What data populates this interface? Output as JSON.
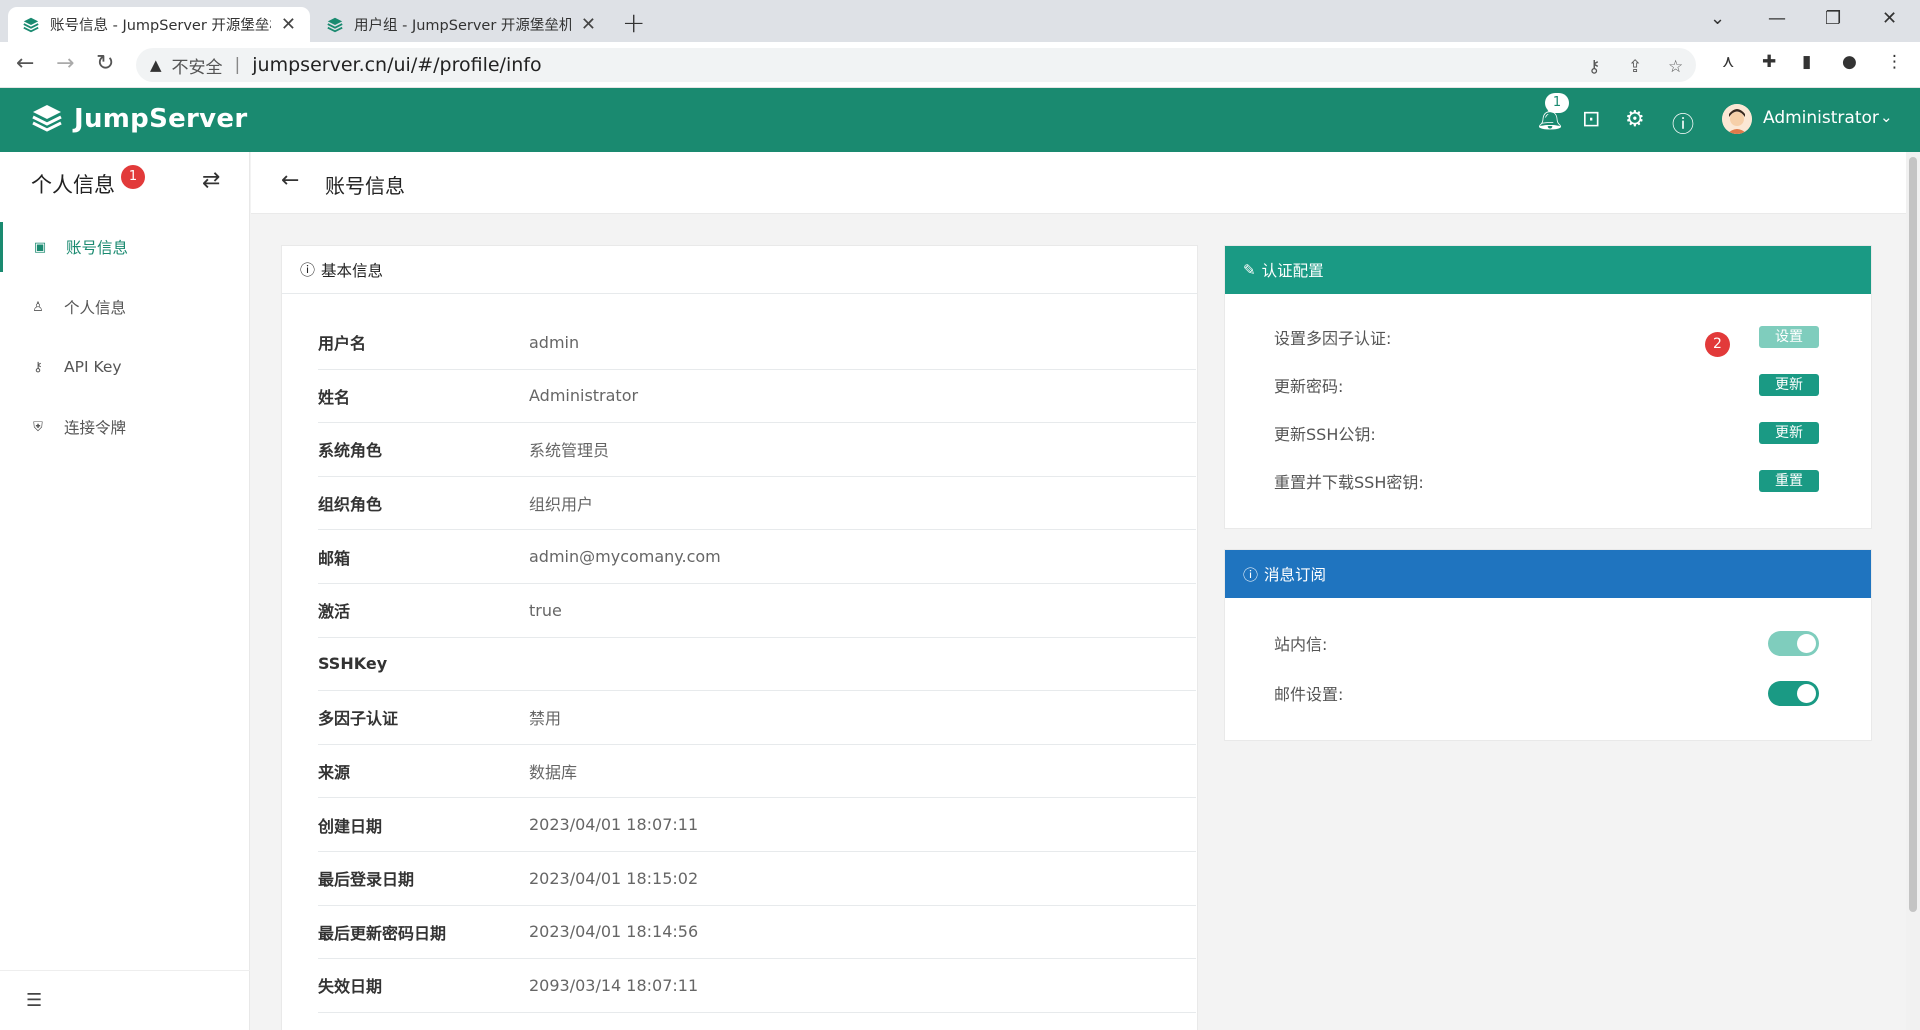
{
  "browser": {
    "tabs": [
      {
        "title": "账号信息 - JumpServer 开源堡垒机",
        "close": "✕"
      },
      {
        "title": "用户组 - JumpServer 开源堡垒机",
        "close": "✕"
      }
    ],
    "new_tab": "+",
    "address": {
      "security_label": "不安全",
      "url": "jumpserver.cn/ui/#/profile/info"
    }
  },
  "app": {
    "brand": "JumpServer",
    "notification_count": "1",
    "user_name": "Administrator",
    "colors": {
      "primary": "#1a8a70",
      "accent": "#1a9a84",
      "info_header": "#1f74bf",
      "badge": "#e23a3a"
    }
  },
  "sidebar": {
    "title": "个人信息",
    "badge": "1",
    "items": [
      {
        "label": "账号信息",
        "icon": "id-card-icon",
        "active": true
      },
      {
        "label": "个人信息",
        "icon": "user-edit-icon",
        "active": false
      },
      {
        "label": "API Key",
        "icon": "key-icon",
        "active": false
      },
      {
        "label": "连接令牌",
        "icon": "shield-icon",
        "active": false
      }
    ]
  },
  "page": {
    "title": "账号信息"
  },
  "basic_info": {
    "title": "基本信息",
    "rows": [
      {
        "label": "用户名",
        "value": "admin"
      },
      {
        "label": "姓名",
        "value": "Administrator"
      },
      {
        "label": "系统角色",
        "value": "系统管理员"
      },
      {
        "label": "组织角色",
        "value": "组织用户"
      },
      {
        "label": "邮箱",
        "value": "admin@mycomany.com"
      },
      {
        "label": "激活",
        "value": "true"
      },
      {
        "label": "SSHKey",
        "value": ""
      },
      {
        "label": "多因子认证",
        "value": "禁用"
      },
      {
        "label": "来源",
        "value": "数据库"
      },
      {
        "label": "创建日期",
        "value": "2023/04/01 18:07:11"
      },
      {
        "label": "最后登录日期",
        "value": "2023/04/01 18:15:02"
      },
      {
        "label": "最后更新密码日期",
        "value": "2023/04/01 18:14:56"
      },
      {
        "label": "失效日期",
        "value": "2093/03/14 18:07:11"
      }
    ]
  },
  "auth_config": {
    "title": "认证配置",
    "badge": "2",
    "rows": [
      {
        "label": "设置多因子认证:",
        "button": "设置"
      },
      {
        "label": "更新密码:",
        "button": "更新"
      },
      {
        "label": "更新SSH公钥:",
        "button": "更新"
      },
      {
        "label": "重置并下载SSH密钥:",
        "button": "重置"
      }
    ]
  },
  "subscription": {
    "title": "消息订阅",
    "rows": [
      {
        "label": "站内信:",
        "enabled": true
      },
      {
        "label": "邮件设置:",
        "enabled": true
      }
    ]
  }
}
